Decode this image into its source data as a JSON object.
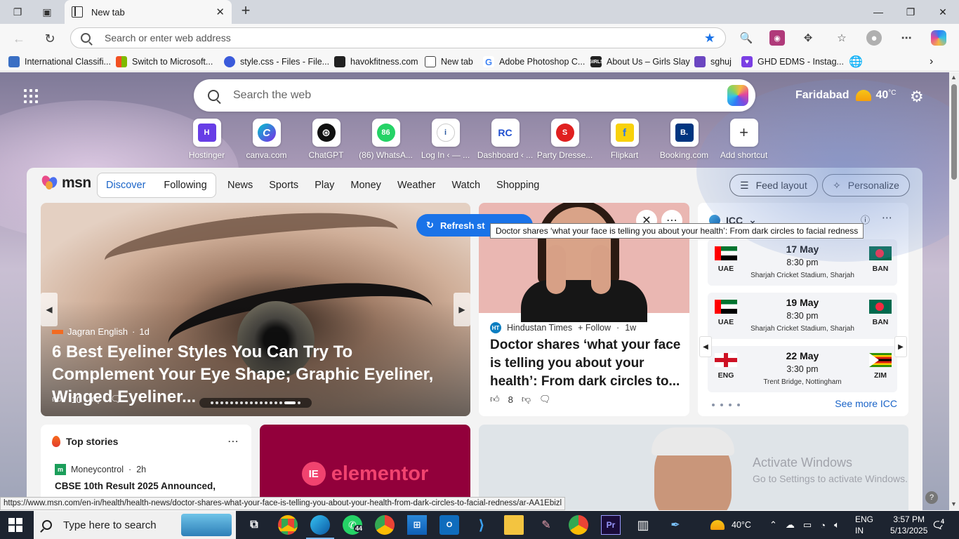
{
  "browser": {
    "tab_title": "New tab",
    "address_placeholder": "Search or enter web address",
    "bookmarks": [
      {
        "label": "International Classifi...",
        "color": "#3a6fc4"
      },
      {
        "label": "Switch to Microsoft...",
        "color": "#f25022"
      },
      {
        "label": "style.css - Files - File...",
        "color": "#3b5bdb"
      },
      {
        "label": "havokfitness.com",
        "color": "#222222"
      },
      {
        "label": "New tab",
        "color": "#444444"
      },
      {
        "label": "Adobe Photoshop C...",
        "color": "#4285f4"
      },
      {
        "label": "About Us – Girls Slay",
        "color": "#222222"
      },
      {
        "label": "sghuj",
        "color": "#6b46c1"
      },
      {
        "label": "GHD EDMS - Instag...",
        "color": "#7b3fe4"
      }
    ]
  },
  "newtab": {
    "search_placeholder": "Search the web",
    "location": "Faridabad",
    "temperature": "40",
    "temperature_unit": "°C",
    "shortcuts": [
      {
        "label": "Hostinger",
        "icon": "H",
        "color": "#673de6"
      },
      {
        "label": "canva.com",
        "icon": "C",
        "color": "#00c4cc"
      },
      {
        "label": "ChatGPT",
        "icon": "⊛",
        "color": "#111111"
      },
      {
        "label": "(86) WhatsA...",
        "icon": "86",
        "color": "#25d366"
      },
      {
        "label": "Log In ‹ — ...",
        "icon": "i",
        "color": "#2c5aa0"
      },
      {
        "label": "Dashboard ‹ ...",
        "icon": "RC",
        "color": "#1f4fd0"
      },
      {
        "label": "Party Dresse...",
        "icon": "S",
        "color": "#e02020"
      },
      {
        "label": "Flipkart",
        "icon": "f",
        "color": "#f8d10b"
      },
      {
        "label": "Booking.com",
        "icon": "B.",
        "color": "#003580"
      },
      {
        "label": "Add shortcut",
        "icon": "+",
        "color": "#ffffff"
      }
    ]
  },
  "msn": {
    "logo_text": "msn",
    "tabs": [
      "Discover",
      "Following"
    ],
    "nav": [
      "News",
      "Sports",
      "Play",
      "Money",
      "Weather",
      "Watch",
      "Shopping"
    ],
    "feed_layout": "Feed layout",
    "personalize": "Personalize",
    "refresh_label": "Refresh st",
    "tooltip": "Doctor shares ‘what your face is telling you about your health’: From dark circles to facial redness",
    "hero": {
      "source": "Jagran English",
      "age": "1d",
      "title": "6 Best Eyeliner Styles You Can Try To Complement Your Eye Shape; Graphic Eyeliner, Winged Eyeliner...",
      "likes": "10"
    },
    "card2": {
      "source": "Hindustan Times",
      "source_icon": "HT",
      "follow": "Follow",
      "age": "1w",
      "title": "Doctor shares ‘what your face is telling you about your health’: From dark circles to...",
      "likes": "8"
    },
    "icc": {
      "title": "ICC",
      "matches": [
        {
          "date": "17 May",
          "time": "8:30 pm",
          "venue": "Sharjah Cricket Stadium, Sharjah",
          "team1": "UAE",
          "team2": "BAN"
        },
        {
          "date": "19 May",
          "time": "8:30 pm",
          "venue": "Sharjah Cricket Stadium, Sharjah",
          "team1": "UAE",
          "team2": "BAN"
        },
        {
          "date": "22 May",
          "time": "3:30 pm",
          "venue": "Trent Bridge, Nottingham",
          "team1": "ENG",
          "team2": "ZIM"
        }
      ],
      "see_more": "See more ICC"
    },
    "top_stories": {
      "title": "Top stories",
      "source": "Moneycontrol",
      "source_icon": "m",
      "age": "2h",
      "headline": "CBSE 10th Result 2025 Announced,"
    },
    "ad": {
      "icon": "IE",
      "text": "elementor"
    }
  },
  "watermark": {
    "line1": "Activate Windows",
    "line2": "Go to Settings to activate Windows."
  },
  "status_url": "https://www.msn.com/en-in/health/health-news/doctor-shares-what-your-face-is-telling-you-about-your-health-from-dark-circles-to-facial-redness/ar-AA1Ebizl",
  "taskbar": {
    "search_placeholder": "Type here to search",
    "whatsapp_badge": "44",
    "temperature": "40°C",
    "lang1": "ENG",
    "lang2": "IN",
    "time": "3:57 PM",
    "date": "5/13/2025",
    "notifications": "4"
  }
}
